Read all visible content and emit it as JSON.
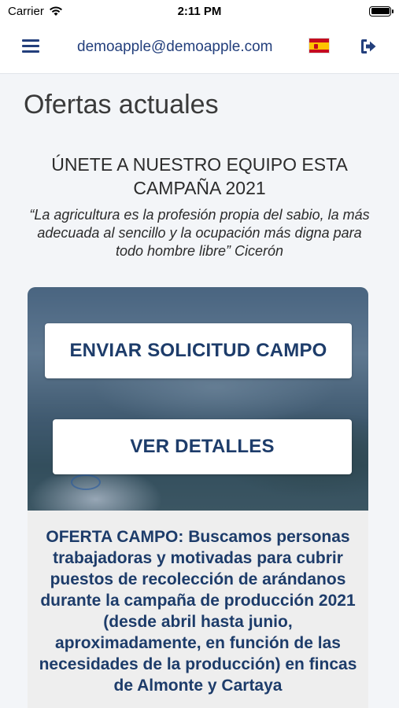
{
  "status_bar": {
    "carrier": "Carrier",
    "time": "2:11 PM"
  },
  "header": {
    "email": "demoapple@demoapple.com",
    "menu_icon": "hamburger-menu-icon",
    "flag_icon": "spain-flag-icon",
    "logout_icon": "sign-out-icon"
  },
  "page": {
    "title": "Ofertas actuales",
    "headline": "ÚNETE A NUESTRO EQUIPO ESTA CAMPAÑA 2021",
    "quote": "“La agricultura es la profesión propia del sabio, la más adecuada al sencillo y la ocupación más digna para todo hombre libre” Cicerón"
  },
  "offer": {
    "apply_button": "ENVIAR SOLICITUD CAMPO",
    "details_button": "VER DETALLES",
    "description": "OFERTA CAMPO: Buscamos personas trabajadoras y motivadas para cubrir puestos de recolección de arándanos durante la campaña de producción 2021 (desde abril hasta junio, aproximadamente, en función de las necesidades de la producción) en fincas de Almonte y Cartaya"
  },
  "colors": {
    "brand_blue": "#233f7c",
    "card_text_blue": "#1d3c6a",
    "page_background": "#f3f5f8"
  }
}
